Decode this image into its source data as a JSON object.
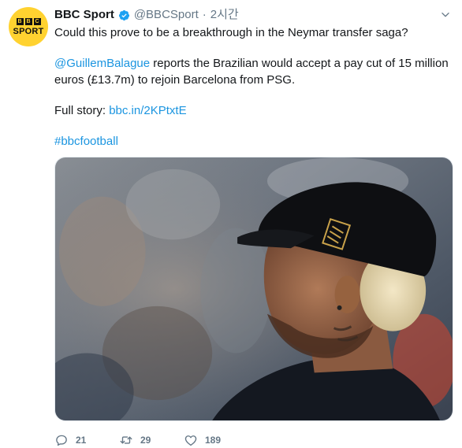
{
  "account": {
    "avatar_top": "BBC",
    "avatar_bottom": "SPORT",
    "name": "BBC Sport",
    "handle": "@BBCSport",
    "separator": "·",
    "time": "2시간"
  },
  "tweet": {
    "line1": "Could this prove to be a breakthrough in the Neymar transfer saga?",
    "mention": "@GuillemBalague",
    "line2_rest": " reports the Brazilian would accept a pay cut of 15 million euros (£13.7m) to rejoin Barcelona from PSG.",
    "story_prefix": "Full story: ",
    "story_link": "bbc.in/2KPtxtE",
    "hashtag": "#bbcfootball"
  },
  "actions": {
    "replies": "21",
    "retweets": "29",
    "likes": "189"
  },
  "icons": {
    "verified": "verified-badge-icon",
    "more": "chevron-down-icon",
    "reply": "reply-icon",
    "retweet": "retweet-icon",
    "like": "heart-icon"
  },
  "colors": {
    "link": "#1b95e0",
    "muted": "#657786",
    "avatar_bg": "#ffd230",
    "verified": "#1da1f2"
  }
}
